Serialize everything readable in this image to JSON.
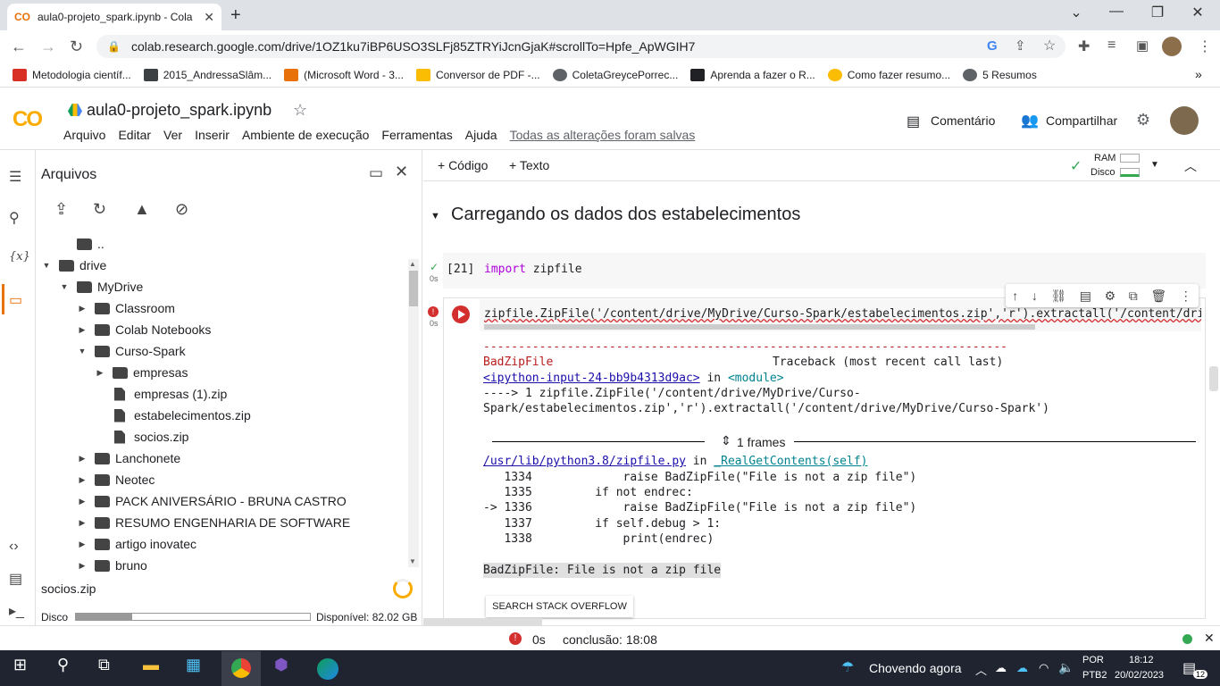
{
  "browser": {
    "tab_title": "aula0-projeto_spark.ipynb - Cola",
    "tab_logo": "CO",
    "url": "colab.research.google.com/drive/1OZ1ku7iBP6USO3SLFj85ZTRYiJcnGjaK#scrollTo=Hpfe_ApWGIH7",
    "bookmarks": [
      {
        "label": "Metodologia científ...",
        "color": "#d93025"
      },
      {
        "label": "2015_AndressaSlâm...",
        "color": "#3c4043"
      },
      {
        "label": "(Microsoft Word - 3...",
        "color": "#e8710a"
      },
      {
        "label": "Conversor de PDF -...",
        "color": "#fbbc04"
      },
      {
        "label": "ColetaGreycePorrec...",
        "color": "#5f6368"
      },
      {
        "label": "Aprenda a fazer o R...",
        "color": "#202124"
      },
      {
        "label": "Como fazer resumo...",
        "color": "#fbbc04"
      },
      {
        "label": "5 Resumos",
        "color": "#5f6368"
      }
    ],
    "bookmarks_more": "»"
  },
  "colab": {
    "logo": "CO",
    "notebook_title": "aula0-projeto_spark.ipynb",
    "menu": [
      "Arquivo",
      "Editar",
      "Ver",
      "Inserir",
      "Ambiente de execução",
      "Ferramentas",
      "Ajuda"
    ],
    "saved_status": "Todas as alterações foram salvas",
    "comment_label": "Comentário",
    "share_label": "Compartilhar"
  },
  "files": {
    "title": "Arquivos",
    "tree": [
      {
        "label": "..",
        "depth": 1,
        "type": "up",
        "arrow": ""
      },
      {
        "label": "drive",
        "depth": 0,
        "type": "folder",
        "arrow": "▼"
      },
      {
        "label": "MyDrive",
        "depth": 1,
        "type": "folder",
        "arrow": "▼"
      },
      {
        "label": "Classroom",
        "depth": 2,
        "type": "folder",
        "arrow": "▶"
      },
      {
        "label": "Colab Notebooks",
        "depth": 2,
        "type": "folder",
        "arrow": "▶"
      },
      {
        "label": "Curso-Spark",
        "depth": 2,
        "type": "folder",
        "arrow": "▼"
      },
      {
        "label": "empresas",
        "depth": 3,
        "type": "folder",
        "arrow": "▶"
      },
      {
        "label": "empresas (1).zip",
        "depth": 3,
        "type": "file",
        "arrow": ""
      },
      {
        "label": "estabelecimentos.zip",
        "depth": 3,
        "type": "file",
        "arrow": ""
      },
      {
        "label": "socios.zip",
        "depth": 3,
        "type": "file",
        "arrow": ""
      },
      {
        "label": "Lanchonete",
        "depth": 2,
        "type": "folder",
        "arrow": "▶"
      },
      {
        "label": "Neotec",
        "depth": 2,
        "type": "folder",
        "arrow": "▶"
      },
      {
        "label": "PACK ANIVERSÁRIO - BRUNA CASTRO",
        "depth": 2,
        "type": "folder",
        "arrow": "▶"
      },
      {
        "label": "RESUMO ENGENHARIA DE SOFTWARE",
        "depth": 2,
        "type": "folder",
        "arrow": "▶"
      },
      {
        "label": "artigo inovatec",
        "depth": 2,
        "type": "folder",
        "arrow": "▶"
      },
      {
        "label": "bruno",
        "depth": 2,
        "type": "folder",
        "arrow": "▶"
      }
    ],
    "uploading_file": "socios.zip",
    "disk_label": "Disco",
    "disk_used_fraction": 0.24,
    "disk_available": "Disponível: 82.02 GB"
  },
  "notebook": {
    "add_code": "+ Código",
    "add_text": "+ Texto",
    "ram_label": "RAM",
    "disk_label": "Disco",
    "section_title": "Carregando os dados dos estabelecimentos",
    "cell1": {
      "exec": "[21]",
      "time": "0s",
      "code_kw": "import",
      "code_rest": " zipfile"
    },
    "cell2": {
      "time": "0s",
      "code": "zipfile.ZipFile('/content/drive/MyDrive/Curso-Spark/estabelecimentos.zip','r').extractall('/content/driv",
      "dashes": "---------------------------------------------------------------------------",
      "error_name": "BadZipFile",
      "traceback_label": "Traceback (most recent call last)",
      "input_link": "<ipython-input-24-bb9b4313d9ac>",
      "in_word": " in ",
      "module": "<module>",
      "arrow_line": "----> 1 zipfile.ZipFile('/content/drive/MyDrive/Curso-",
      "arrow_line2": "Spark/estabelecimentos.zip','r').extractall('/content/drive/MyDrive/Curso-Spark')",
      "frames_label": "1 frames",
      "file_link": "/usr/lib/python3.8/zipfile.py",
      "func": "_RealGetContents(self)",
      "lines": [
        "   1334             raise BadZipFile(\"File is not a zip file\")",
        "   1335         if not endrec:",
        "-> 1336             raise BadZipFile(\"File is not a zip file\")",
        "   1337         if self.debug > 1:",
        "   1338             print(endrec)"
      ],
      "final_error": "BadZipFile: File is not a zip file",
      "stack_button": "SEARCH STACK OVERFLOW"
    }
  },
  "statusbar": {
    "time": "0s",
    "completion": "conclusão: 18:08"
  },
  "taskbar": {
    "weather": "Chovendo agora",
    "lang1": "POR",
    "lang2": "PTB2",
    "clock_time": "18:12",
    "clock_date": "20/02/2023",
    "notif_count": "12"
  }
}
